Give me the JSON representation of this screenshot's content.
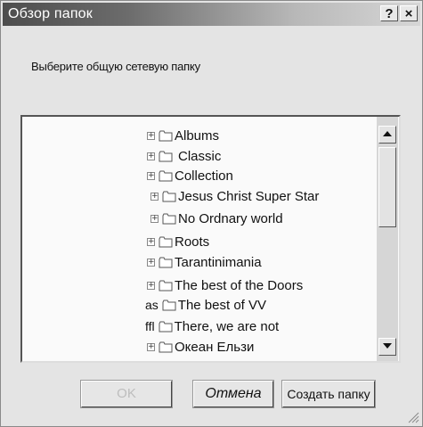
{
  "window": {
    "title": "Обзор папок",
    "help_label": "?",
    "close_label": "×"
  },
  "prompt": "Выберите общую сетевую папку",
  "tree": {
    "items": [
      {
        "label": "Albums",
        "expander": "+"
      },
      {
        "label": "Classic",
        "expander": "+"
      },
      {
        "label": "Collection",
        "expander": "+"
      },
      {
        "label": "Jesus Christ Super Star",
        "expander": "+"
      },
      {
        "label": "No Ordnary world",
        "expander": "+"
      },
      {
        "label": "Roots",
        "expander": "+"
      },
      {
        "label": "Tarantinimania",
        "expander": "+"
      },
      {
        "label": "The best of the Doors",
        "expander": "+"
      },
      {
        "label": "The best of VV",
        "prefix": "as"
      },
      {
        "label": "There, we are not",
        "prefix": "ffl"
      },
      {
        "label": "Океан Ельзи",
        "expander": "+"
      }
    ]
  },
  "buttons": {
    "ok": "OK",
    "cancel": "Отмена",
    "new_folder": "Создать папку"
  }
}
